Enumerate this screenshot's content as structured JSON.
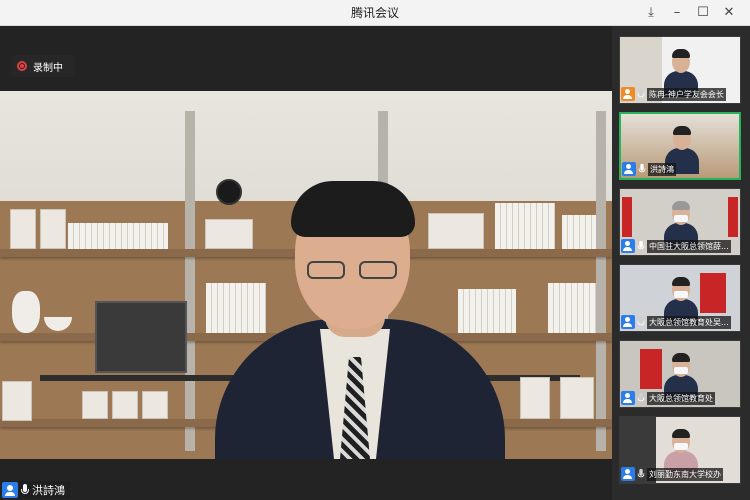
{
  "window": {
    "title": "腾讯会议",
    "controls": [
      "pin-icon",
      "minimize-icon",
      "maximize-icon",
      "close-icon"
    ]
  },
  "recording": {
    "label": "录制中",
    "icon": "record-icon",
    "color": "#e04040"
  },
  "main_speaker": {
    "name": "洪詩鴻",
    "mic": "on"
  },
  "participants": [
    {
      "name": "陈冉-神户学友会会长",
      "avatar_color": "#f08a24",
      "mic": "off",
      "active": false
    },
    {
      "name": "洪詩鴻",
      "avatar_color": "#2b7de9",
      "mic": "on",
      "active": true
    },
    {
      "name": "中国驻大阪总领馆薛...",
      "avatar_color": "#2b7de9",
      "mic": "on",
      "active": false
    },
    {
      "name": "大阪总领馆教育处吴...",
      "avatar_color": "#2b7de9",
      "mic": "off",
      "active": false
    },
    {
      "name": "大阪总领馆教育处",
      "avatar_color": "#2b7de9",
      "mic": "off",
      "active": false
    },
    {
      "name": "刘丽勤东南大学校办",
      "avatar_color": "#2b7de9",
      "mic": "off",
      "active": false
    }
  ],
  "colors": {
    "active_border": "#26b35a",
    "accent": "#2b7de9"
  }
}
